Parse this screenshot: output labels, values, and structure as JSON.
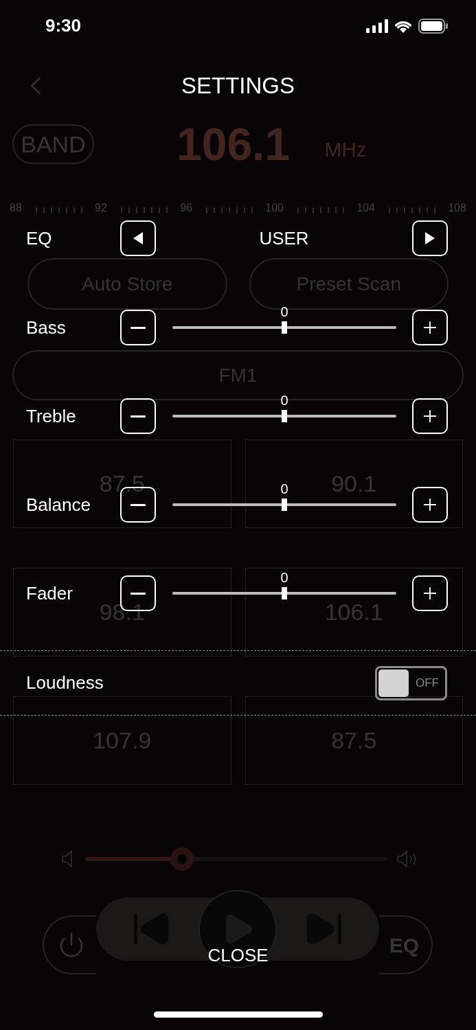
{
  "status_bar": {
    "time": "9:30"
  },
  "background": {
    "band_button": "BAND",
    "frequency": "106.1",
    "unit": "MHz",
    "scale_labels": [
      "88",
      "92",
      "96",
      "100",
      "104",
      "108"
    ],
    "actions": [
      "Auto Store",
      "Preset Scan"
    ],
    "band": "FM1",
    "presets": [
      "87.5",
      "90.1",
      "98.1",
      "106.1",
      "107.9",
      "87.5"
    ],
    "volume": {
      "level": 0.32
    },
    "eq_button": "EQ"
  },
  "settings": {
    "title": "SETTINGS",
    "eq": {
      "label": "EQ",
      "preset": "USER"
    },
    "sliders": [
      {
        "label": "Bass",
        "value": "0",
        "level": 0.5
      },
      {
        "label": "Treble",
        "value": "0",
        "level": 0.5
      },
      {
        "label": "Balance",
        "value": "0",
        "level": 0.5
      },
      {
        "label": "Fader",
        "value": "0",
        "level": 0.5
      }
    ],
    "loudness": {
      "label": "Loudness",
      "on": false,
      "state_label": "OFF"
    },
    "close": "CLOSE"
  }
}
